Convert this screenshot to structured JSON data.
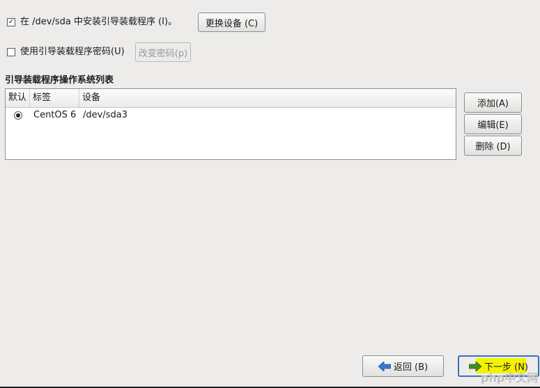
{
  "install_bootloader": {
    "checked": true,
    "label": "在 /dev/sda 中安装引导装载程序 (I)。",
    "change_device_label": "更换设备 (C)"
  },
  "use_password": {
    "checked": false,
    "label": "使用引导装载程序密码(U)",
    "change_password_label": "改变密码(p)"
  },
  "os_list": {
    "title": "引导装载程序操作系统列表",
    "columns": [
      "默认",
      "标签",
      "设备"
    ],
    "rows": [
      {
        "default": true,
        "label": "CentOS 6",
        "device": "/dev/sda3"
      }
    ]
  },
  "side_buttons": {
    "add": "添加(A)",
    "edit": "编辑(E)",
    "delete": "删除 (D)"
  },
  "nav": {
    "back_label": "返回 (B)",
    "next_label": "下一步 (N)"
  },
  "watermark": {
    "text": "php中文网"
  },
  "colors": {
    "back_arrow": "#3a78c9",
    "next_arrow": "#3f8f1e",
    "highlight": "#f4f200"
  }
}
